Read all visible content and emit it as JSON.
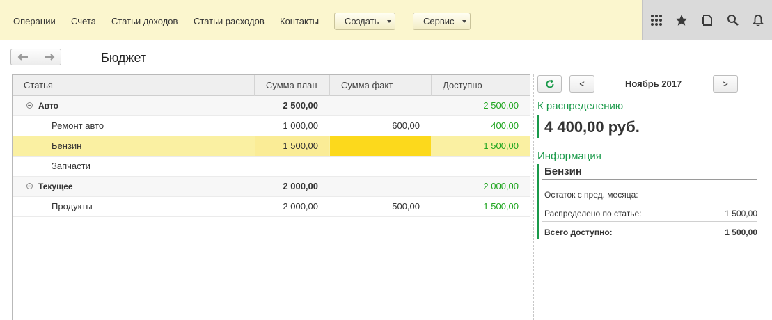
{
  "menu": {
    "items": [
      "Операции",
      "Счета",
      "Статьи доходов",
      "Статьи расходов",
      "Контакты"
    ],
    "create_label": "Создать",
    "service_label": "Сервис"
  },
  "top_icons": [
    "apps-grid-icon",
    "star-icon",
    "history-icon",
    "search-icon",
    "bell-icon"
  ],
  "page": {
    "title": "Бюджет"
  },
  "table": {
    "columns": [
      "Статья",
      "Сумма план",
      "Сумма факт",
      "Доступно"
    ],
    "rows": [
      {
        "name": "Авто",
        "plan": "2 500,00",
        "fact": "",
        "avail": "2 500,00",
        "group": true
      },
      {
        "name": "Ремонт авто",
        "plan": "1 000,00",
        "fact": "600,00",
        "avail": "400,00",
        "group": false
      },
      {
        "name": "Бензин",
        "plan": "1 500,00",
        "fact": "",
        "avail": "1 500,00",
        "group": false,
        "selected": true
      },
      {
        "name": "Запчасти",
        "plan": "",
        "fact": "",
        "avail": "",
        "group": false
      },
      {
        "name": "Текущее",
        "plan": "2 000,00",
        "fact": "",
        "avail": "2 000,00",
        "group": true
      },
      {
        "name": "Продукты",
        "plan": "2 000,00",
        "fact": "500,00",
        "avail": "1 500,00",
        "group": false
      }
    ]
  },
  "panel": {
    "prev_label": "<",
    "next_label": ">",
    "month": "Ноябрь 2017",
    "to_distribute_label": "К распределению",
    "to_distribute_amount": "4 400,00 руб.",
    "info_label": "Информация",
    "info_item": "Бензин",
    "info_rows": [
      {
        "label": "Остаток с пред. месяца:",
        "value": ""
      },
      {
        "label": "Распределено по статье:",
        "value": "1 500,00"
      },
      {
        "label": "Всего доступно:",
        "value": "1 500,00"
      }
    ]
  },
  "colors": {
    "menu_bg": "#fbf6ce",
    "accent_green": "#1a9a4a",
    "available_green": "#1fa51f",
    "selected_row": "#faf0a2",
    "active_cell": "#fcd91c"
  }
}
